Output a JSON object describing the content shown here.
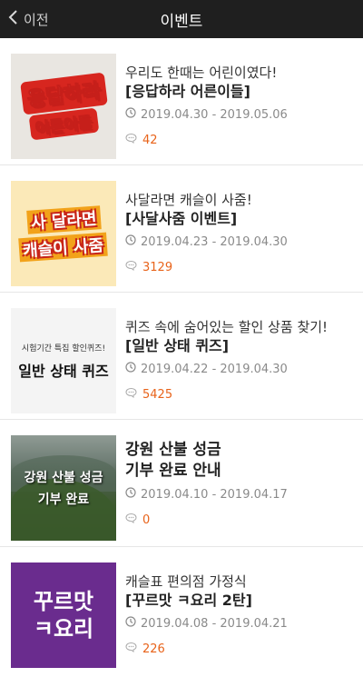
{
  "header": {
    "back_label": "이전",
    "title": "이벤트"
  },
  "events": [
    {
      "thumb_lines": [
        "응답하라",
        "어른이들"
      ],
      "subtitle": "우리도 한때는 어린이였다!",
      "title": "[응답하라 어른이들]",
      "date_range": "2019.04.30 - 2019.05.06",
      "comment_count": "42"
    },
    {
      "thumb_lines": [
        "사 달라면",
        "캐슬이 사줌"
      ],
      "subtitle": "사달라면 캐슬이 사줌!",
      "title": "[사달사줌 이벤트]",
      "date_range": "2019.04.23 - 2019.04.30",
      "comment_count": "3129"
    },
    {
      "thumb_lines": [
        "시험기간 특집 할인퀴즈!",
        "일반 상태 퀴즈"
      ],
      "subtitle": "퀴즈 속에 숨어있는 할인 상품 찾기!",
      "title": "[일반 상태 퀴즈]",
      "date_range": "2019.04.22 - 2019.04.30",
      "comment_count": "5425"
    },
    {
      "thumb_lines": [
        "강원 산불 성금",
        "기부 완료"
      ],
      "subtitle": "",
      "title_lines": [
        "강원 산불 성금",
        "기부 완료 안내"
      ],
      "date_range": "2019.04.10 - 2019.04.17",
      "comment_count": "0"
    },
    {
      "thumb_lines": [
        "꾸르맛",
        "ㅋ요리"
      ],
      "subtitle": "캐슬표 편의점 가정식",
      "title": "[꾸르맛 ㅋ요리 2탄]",
      "date_range": "2019.04.08 - 2019.04.21",
      "comment_count": "226"
    }
  ],
  "colors": {
    "header_bg": "#1f1f1f",
    "comment_accent": "#e8631a",
    "date_gray": "#8a8a8a"
  },
  "icons": {
    "back": "chevron-left-icon",
    "date": "clock-icon",
    "comments": "speech-bubble-icon"
  }
}
